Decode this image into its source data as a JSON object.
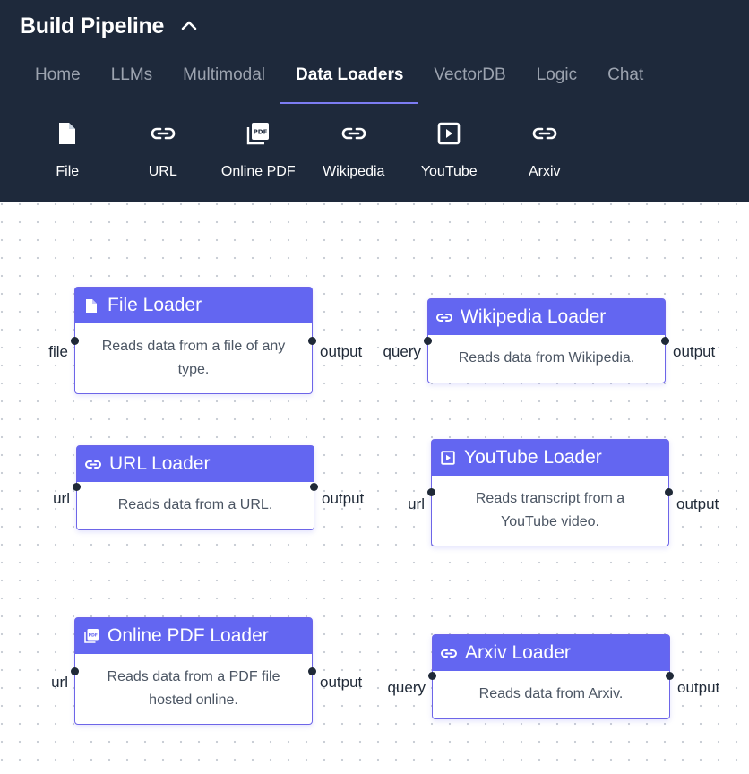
{
  "header": {
    "title": "Build Pipeline",
    "bg_color": "#1e293b",
    "collapse_icon": "chevron-up-icon"
  },
  "tabs": [
    {
      "label": "Home",
      "active": false
    },
    {
      "label": "LLMs",
      "active": false
    },
    {
      "label": "Multimodal",
      "active": false
    },
    {
      "label": "Data Loaders",
      "active": true
    },
    {
      "label": "VectorDB",
      "active": false
    },
    {
      "label": "Logic",
      "active": false
    },
    {
      "label": "Chat",
      "active": false
    }
  ],
  "toolbar": [
    {
      "label": "File",
      "icon": "file-icon"
    },
    {
      "label": "URL",
      "icon": "link-icon"
    },
    {
      "label": "Online PDF",
      "icon": "pdf-icon"
    },
    {
      "label": "Wikipedia",
      "icon": "link-icon"
    },
    {
      "label": "YouTube",
      "icon": "play-icon"
    },
    {
      "label": "Arxiv",
      "icon": "link-icon"
    }
  ],
  "nodes": {
    "file": {
      "title": "File Loader",
      "description": "Reads data from a file of any type.",
      "input": "file",
      "output": "output",
      "icon": "file-icon"
    },
    "wikipedia": {
      "title": "Wikipedia Loader",
      "description": "Reads data from Wikipedia.",
      "input": "query",
      "output": "output",
      "icon": "link-icon"
    },
    "url": {
      "title": "URL Loader",
      "description": "Reads data from a URL.",
      "input": "url",
      "output": "output",
      "icon": "link-icon"
    },
    "youtube": {
      "title": "YouTube Loader",
      "description": "Reads transcript from a YouTube video.",
      "input": "url",
      "output": "output",
      "icon": "play-icon"
    },
    "pdf": {
      "title": "Online PDF Loader",
      "description": "Reads data from a PDF file hosted online.",
      "input": "url",
      "output": "output",
      "icon": "pdf-icon"
    },
    "arxiv": {
      "title": "Arxiv Loader",
      "description": "Reads data from Arxiv.",
      "input": "query",
      "output": "output",
      "icon": "link-icon"
    }
  },
  "colors": {
    "accent": "#6366f1",
    "active_tab_underline": "#7c7cf2",
    "handle": "#1f2937"
  }
}
